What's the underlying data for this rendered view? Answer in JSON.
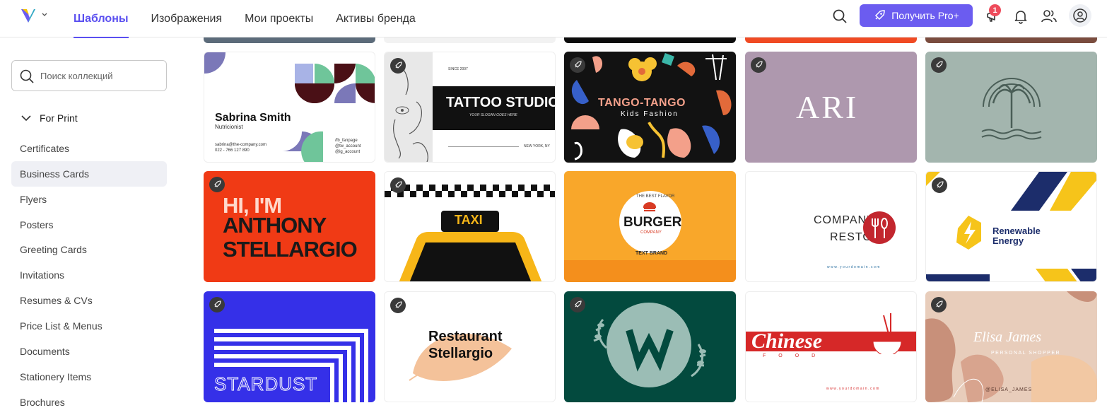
{
  "nav": {
    "tabs": [
      "Шаблоны",
      "Изображения",
      "Мои проекты",
      "Активы бренда"
    ],
    "active": 0
  },
  "header": {
    "pro_button": "Получить Pro+",
    "notification_count": "1"
  },
  "sidebar": {
    "search_placeholder": "Поиск коллекций",
    "section_title": "For Print",
    "items": [
      "Certificates",
      "Business Cards",
      "Flyers",
      "Posters",
      "Greeting Cards",
      "Invitations",
      "Resumes & CVs",
      "Price List & Menus",
      "Documents",
      "Stationery Items",
      "Brochures"
    ],
    "active_item": 1
  },
  "templates": {
    "sabrina": {
      "name": "Sabrina Smith",
      "role": "Nutricionist",
      "email": "sabrina@the-company.com",
      "phone": "022 - 766 127 890",
      "fb": "/fb_fanpage",
      "tw": "@tw_account",
      "ig": "@ig_account"
    },
    "tattoo": {
      "since": "SINCE 2007",
      "title": "TATTOO STUDIO",
      "slogan": "YOUR SLOGAN GOES HERE",
      "city": "NEW YORK, NY"
    },
    "tango": {
      "title": "TANGO-TANGO",
      "subtitle": "Kids Fashion"
    },
    "ari": {
      "title": "ARI"
    },
    "anthony": {
      "line1": "HI, I'M",
      "line2": "ANTHONY",
      "line3": "STELLARGIO"
    },
    "taxi": {
      "label": "TAXI"
    },
    "burger": {
      "top": "THE BEST FLAVOR",
      "title": "BURGER",
      "company": "COMPANY",
      "brand": "TEXT BRAND"
    },
    "resto": {
      "line1": "COMPANY",
      "line2": "RESTO",
      "domain": "www.yourdomain.com"
    },
    "renewable": {
      "line1": "Renewable",
      "line2": "Energy"
    },
    "stardust": {
      "title": "STARDUST"
    },
    "restaurant": {
      "line1": "Restaurant",
      "line2": "Stellargio"
    },
    "chinese": {
      "title": "Chinese",
      "sub": "FOOD",
      "domain": "www.yourdomain.com"
    },
    "elisa": {
      "name": "Elisa James",
      "role": "PERSONAL SHOPPER",
      "handle": "@ELISA_JAMES"
    }
  },
  "colors": {
    "accent": "#5a4ff0",
    "pro_button": "#6b5cf0",
    "badge": "#ee4b5b"
  }
}
